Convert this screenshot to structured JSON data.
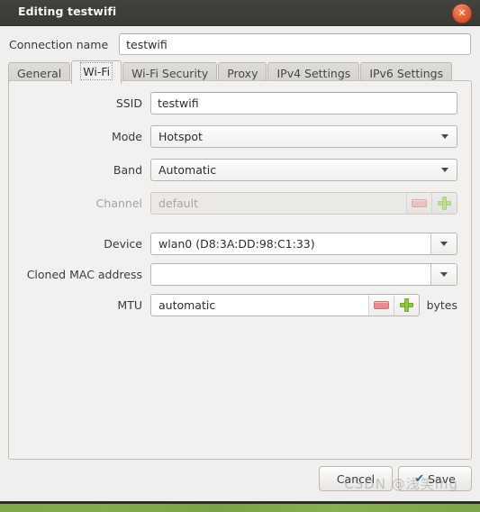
{
  "window": {
    "title": "Editing testwifi",
    "close_icon": "close-icon",
    "close_glyph": "✕"
  },
  "connection": {
    "label": "Connection name",
    "value": "testwifi"
  },
  "tabs": [
    {
      "label": "General",
      "active": false
    },
    {
      "label": "Wi-Fi",
      "active": true
    },
    {
      "label": "Wi-Fi Security",
      "active": false
    },
    {
      "label": "Proxy",
      "active": false
    },
    {
      "label": "IPv4 Settings",
      "active": false
    },
    {
      "label": "IPv6 Settings",
      "active": false
    }
  ],
  "form": {
    "ssid": {
      "label": "SSID",
      "value": "testwifi"
    },
    "mode": {
      "label": "Mode",
      "value": "Hotspot"
    },
    "band": {
      "label": "Band",
      "value": "Automatic"
    },
    "channel": {
      "label": "Channel",
      "value": "default",
      "disabled": true,
      "minus_icon": "minus-icon",
      "plus_icon": "plus-icon"
    },
    "device": {
      "label": "Device",
      "value": "wlan0 (D8:3A:DD:98:C1:33)"
    },
    "cloned_mac": {
      "label": "Cloned MAC address",
      "value": ""
    },
    "mtu": {
      "label": "MTU",
      "value": "automatic",
      "unit": "bytes",
      "minus_icon": "minus-icon",
      "plus_icon": "plus-icon"
    }
  },
  "footer": {
    "cancel_label": "Cancel",
    "save_label": "Save",
    "save_check_glyph": "✔"
  },
  "watermark": {
    "text": "CSDN @浅笑ing"
  },
  "colors": {
    "titlebar": "#3c3b37",
    "window_bg": "#f0efed",
    "panel_bg": "#f2f1ef",
    "accent_close": "#e2633a",
    "plus_green": "#8fc93f",
    "minus_red": "#e88d8d",
    "check_blue": "#2d63a8",
    "desktop_green": "#7fa84a"
  }
}
